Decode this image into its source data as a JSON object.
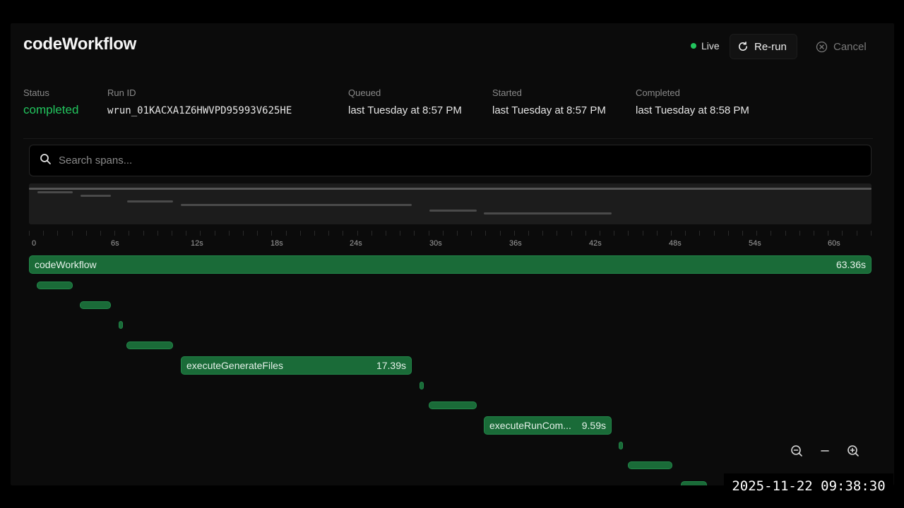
{
  "header": {
    "title": "codeWorkflow",
    "live_label": "Live",
    "rerun_label": "Re-run",
    "cancel_label": "Cancel"
  },
  "meta": {
    "status": {
      "label": "Status",
      "value": "completed"
    },
    "run_id": {
      "label": "Run ID",
      "value": "wrun_01KACXA1Z6HWVPD95993V625HE"
    },
    "queued": {
      "label": "Queued",
      "value": "last Tuesday at 8:57 PM"
    },
    "started": {
      "label": "Started",
      "value": "last Tuesday at 8:57 PM"
    },
    "completed": {
      "label": "Completed",
      "value": "last Tuesday at 8:58 PM"
    }
  },
  "search": {
    "placeholder": "Search spans..."
  },
  "timeline": {
    "ticks": [
      "0",
      "6s",
      "12s",
      "18s",
      "24s",
      "30s",
      "36s",
      "42s",
      "48s",
      "54s",
      "60s"
    ],
    "spans": [
      {
        "name": "codeWorkflow",
        "duration": "63.36s"
      },
      {
        "name": "executeGenerateFiles",
        "duration": "17.39s"
      },
      {
        "name": "executeRunCom...",
        "duration": "9.59s"
      }
    ]
  },
  "icons": {
    "rerun": "refresh-icon",
    "cancel": "close-circle-icon",
    "search": "search-icon",
    "zoom_out": "zoom-out-icon",
    "reset": "minus-icon",
    "zoom_in": "zoom-in-icon"
  },
  "colors": {
    "status_completed": "#22c55e",
    "span_fill": "#1a6b38",
    "live_dot": "#22c55e"
  },
  "overlay": {
    "timestamp": "2025-11-22 09:38:30"
  }
}
